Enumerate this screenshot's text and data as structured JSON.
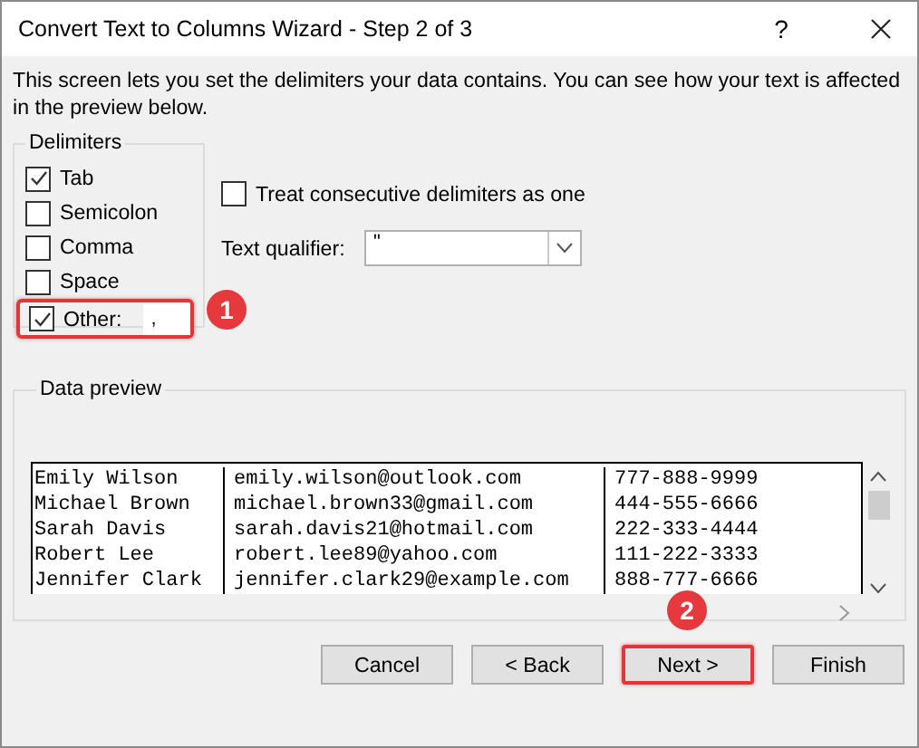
{
  "window": {
    "title": "Convert Text to Columns Wizard - Step 2 of 3",
    "help": "?"
  },
  "intro": "This screen lets you set the delimiters your data contains.  You can see how your text is affected in the preview below.",
  "delimiters": {
    "title": "Delimiters",
    "options": [
      {
        "label": "Tab",
        "checked": true
      },
      {
        "label": "Semicolon",
        "checked": false
      },
      {
        "label": "Comma",
        "checked": false
      },
      {
        "label": "Space",
        "checked": false
      },
      {
        "label": "Other:",
        "checked": true,
        "value": ",",
        "highlighted": true,
        "annotation": "1"
      }
    ]
  },
  "treat_consecutive": {
    "label": "Treat consecutive delimiters as one",
    "checked": false
  },
  "text_qualifier": {
    "label": "Text qualifier:",
    "value": "\""
  },
  "data_preview": {
    "title": "Data preview",
    "rows": [
      [
        "Emily Wilson",
        "emily.wilson@outlook.com",
        "777-888-9999"
      ],
      [
        "Michael Brown",
        "michael.brown33@gmail.com",
        "444-555-6666"
      ],
      [
        "Sarah Davis",
        "sarah.davis21@hotmail.com",
        "222-333-4444"
      ],
      [
        "Robert Lee",
        "robert.lee89@yahoo.com",
        "111-222-3333"
      ],
      [
        "Jennifer Clark",
        "jennifer.clark29@example.com",
        "888-777-6666"
      ]
    ]
  },
  "buttons": [
    {
      "label": "Cancel",
      "highlighted": false
    },
    {
      "label": "< Back",
      "highlighted": false
    },
    {
      "label": "Next >",
      "highlighted": true,
      "annotation": "2"
    },
    {
      "label": "Finish",
      "highlighted": false
    }
  ]
}
